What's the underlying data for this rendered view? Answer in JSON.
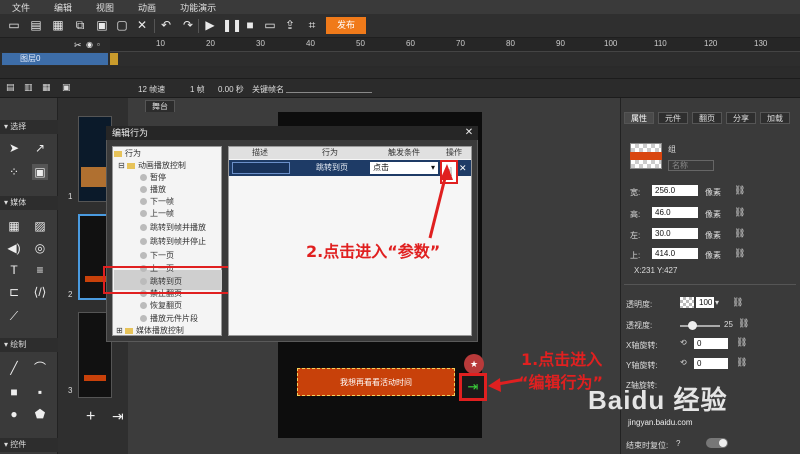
{
  "menu": [
    "文件",
    "编辑",
    "视图",
    "动画",
    "功能演示"
  ],
  "toolbar": {
    "publish_label": "发布",
    "icons": [
      "new-file-icon",
      "open-icon",
      "save-icon",
      "copy-icon",
      "paste-icon",
      "delete-icon",
      "undo-icon",
      "redo-icon",
      "play-icon",
      "pause-icon",
      "stop-icon",
      "preview-icon",
      "screen-icon",
      "share-icon",
      "js-icon"
    ]
  },
  "timeline": {
    "ruler": [
      "10",
      "20",
      "30",
      "40",
      "50",
      "60",
      "70",
      "80",
      "90",
      "100",
      "110",
      "120",
      "130"
    ],
    "layer_name": "图层0"
  },
  "timeline_bar": {
    "fps": "12 帧速",
    "frame": "1 帧",
    "time": "0.00 秒",
    "keyframe_label": "关键帧名"
  },
  "tools": {
    "select": "选择",
    "media": "媒体",
    "draw": "绘制",
    "control": "控件"
  },
  "thumbs": [
    "1",
    "2",
    "3"
  ],
  "stage": {
    "tab": "舞台",
    "cta_text": "我想再看看活动时间"
  },
  "dialog": {
    "title": "编辑行为",
    "tree": {
      "root": "行为",
      "folder1": "动画播放控制",
      "items": [
        "暂停",
        "播放",
        "下一帧",
        "上一帧",
        "跳转到帧并播放",
        "跳转到帧并停止",
        "下一页",
        "上一页",
        "跳转到页",
        "禁止翻页",
        "恢复翻页",
        "播放元件片段"
      ],
      "folder2": "媒体播放控制"
    },
    "columns": [
      "描述",
      "行为",
      "触发条件",
      "操作"
    ],
    "row": {
      "desc": "",
      "action": "跳转到页",
      "trigger": "点击"
    }
  },
  "annotations": {
    "step1_line1": "1.点击进入",
    "step1_line2": "“编辑行为”",
    "step2": "2.点击进入“参数”"
  },
  "props": {
    "tabs": [
      "属性",
      "元件",
      "翻页",
      "分享",
      "加载"
    ],
    "group_label": "组",
    "name_placeholder": "名称",
    "width_label": "宽:",
    "width": "256.0",
    "height_label": "高:",
    "height": "46.0",
    "left_label": "左:",
    "left": "30.0",
    "top_label": "上:",
    "top": "414.0",
    "unit": "像素",
    "coords": "X:231    Y:427",
    "opacity_label": "透明度:",
    "opacity": "100",
    "blur_label": "透视度:",
    "blur": "25",
    "xrot_label": "X轴旋转:",
    "xrot": "0",
    "yrot_label": "Y轴旋转:",
    "yrot": "0",
    "zrot_label": "Z轴旋转:",
    "reset_label": "结束时复位:"
  },
  "watermark": {
    "text": "Baidu 经验",
    "sub": "jingyan.baidu.com"
  }
}
